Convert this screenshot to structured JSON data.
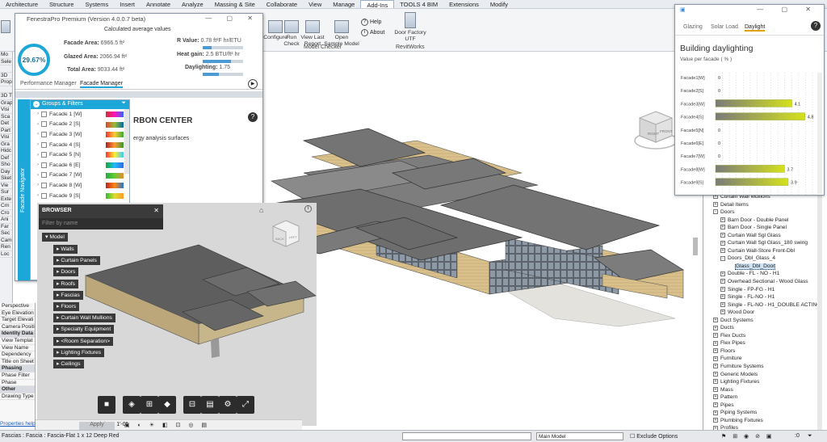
{
  "ribbon": {
    "tabs": [
      "Architecture",
      "Structure",
      "Systems",
      "Insert",
      "Annotate",
      "Analyze",
      "Massing & Site",
      "Collaborate",
      "View",
      "Manage",
      "Add-Ins",
      "TOOLS 4 BIM",
      "Extensions",
      "Modify"
    ],
    "active_tab": "Add-Ins",
    "buttons": {
      "configure": "Configure",
      "run_check": "Run\nCheck",
      "view_last_report": "View Last\nReport",
      "open_sample_model": "Open\nSample Model",
      "help": "Help",
      "about": "About",
      "door_factory": "Door Factory UTF"
    },
    "panels": {
      "model_checker": "Model Checker",
      "revitworks": "RevitWorks"
    }
  },
  "fenestrapro": {
    "title": "FenestraPro Premium (Version 4.0.0.7 beta)",
    "calc_title": "Calculated average values",
    "ratio": "29.67%",
    "facade_area_label": "Facade Area:",
    "facade_area_value": "6966.5 ft²",
    "glazed_area_label": "Glazed Area:",
    "glazed_area_value": "2066.94 ft²",
    "total_area_label": "Total Area:",
    "total_area_value": "9033.44 ft²",
    "r_value_label": "R Value:",
    "r_value": "0.78 ft²F hr/ETU",
    "heat_gain_label": "Heat gain:",
    "heat_gain": "2.5 BTU/ft² hr",
    "daylighting_label": "Daylighting:",
    "daylighting": "1.75",
    "tabs": [
      "Performance Manager",
      "Facade Manager"
    ],
    "active_tab": "Facade Manager",
    "groups_label": "Groups & Filters",
    "facade_navigator_label": "Facade Navigator",
    "right_title": "RBON CENTER",
    "right_sub": "ergy analysis surfaces",
    "facades": [
      "Facade 1 [W]",
      "Facade 2 [S]",
      "Facade 3 [W]",
      "Facade 4 [S]",
      "Facade 5 [N]",
      "Facade 6 [E]",
      "Facade 7 [W]",
      "Facade 8 [W]",
      "Facade 9 [S]"
    ]
  },
  "browser": {
    "title": "BROWSER",
    "filter_placeholder": "Filter by name",
    "root": "Model",
    "items": [
      "Walls",
      "Curtain Panels",
      "Doors",
      "Roofs",
      "Fascias",
      "Floors",
      "Curtain Wall Mullions",
      "Specialty Equipment",
      "<Room Separation>",
      "Lighting Fixtures",
      "Ceilings"
    ],
    "cube_labels": [
      "BACK",
      "LEFT"
    ]
  },
  "viewport": {
    "cube_labels": [
      "RIGHT",
      "FRONT"
    ]
  },
  "left_strip": [
    "Mo",
    "Sele",
    "",
    "3D",
    "Prop",
    "",
    "3D T",
    "Grap",
    "Visi",
    "Sca",
    "Det",
    "Part",
    "Visi",
    "Gra",
    "Hidc",
    "Def",
    "Sho",
    "Day",
    "Sket",
    "Vie",
    "Sur",
    "Exte",
    "Crn",
    "Cro",
    "Ani",
    "Far",
    "Sec",
    "Cam",
    "Ren",
    "Loc"
  ],
  "properties": [
    {
      "t": "Perspective",
      "h": false
    },
    {
      "t": "Eye Elevation",
      "h": false
    },
    {
      "t": "Target Elevati",
      "h": false
    },
    {
      "t": "Camera Positi",
      "h": false
    },
    {
      "t": "Identity Data",
      "h": true
    },
    {
      "t": "View Templat",
      "h": false
    },
    {
      "t": "View Name",
      "h": false
    },
    {
      "t": "Dependency",
      "h": false
    },
    {
      "t": "Title on Sheet",
      "h": false
    },
    {
      "t": "Phasing",
      "h": true
    },
    {
      "t": "Phase Filter",
      "h": false
    },
    {
      "t": "Phase",
      "h": false
    },
    {
      "t": "Other",
      "h": true
    },
    {
      "t": "Drawing Type",
      "h": false
    }
  ],
  "properties_help": "Properties help",
  "apply_label": "Apply",
  "daylight": {
    "tabs": [
      "Glazing",
      "Solar Load",
      "Daylight"
    ],
    "active_tab": "Daylight",
    "heading": "Building daylighting",
    "subheading": "Value per facade ( % )"
  },
  "chart_data": {
    "type": "bar",
    "orientation": "horizontal",
    "title": "Building daylighting",
    "subtitle": "Value per facade ( % )",
    "categories": [
      "Facade1[W]",
      "Facade2[S]",
      "Facade3[W]",
      "Facade4[S]",
      "Facade5[N]",
      "Facade6[E]",
      "Facade7[W]",
      "Facade8[W]",
      "Facade9[S]"
    ],
    "values": [
      0,
      0,
      4.1,
      4.8,
      0,
      0,
      0,
      3.7,
      3.9
    ],
    "value_labels": [
      "0",
      "0",
      "4.1",
      "4.8",
      "0",
      "0",
      "0",
      "3.7",
      "3.9"
    ],
    "xlim": [
      0,
      5.2
    ],
    "bar_colors": {
      "start": "#7a7a7a",
      "end": "#d4e21a"
    }
  },
  "project_tree": [
    {
      "t": "Curtain Wall Mullions",
      "lvl": 1,
      "pm": "+"
    },
    {
      "t": "Detail Items",
      "lvl": 1,
      "pm": "+"
    },
    {
      "t": "Doors",
      "lvl": 1,
      "pm": "-"
    },
    {
      "t": "Barn Door - Double Panel",
      "lvl": 2,
      "pm": "+"
    },
    {
      "t": "Barn Door - Single Panel",
      "lvl": 2,
      "pm": "+"
    },
    {
      "t": "Curtain Wall Sgl Glass",
      "lvl": 2,
      "pm": "+"
    },
    {
      "t": "Curtain Wall Sgl Glass_180 swing",
      "lvl": 2,
      "pm": "+"
    },
    {
      "t": "Curtain Wall-Store Front-Dbl",
      "lvl": 2,
      "pm": "+"
    },
    {
      "t": "Doors_Dbl_Glass_4",
      "lvl": 2,
      "pm": "-"
    },
    {
      "t": "Glass_Dbl_Door",
      "lvl": 3,
      "pm": "",
      "sel": true
    },
    {
      "t": "Double - FL - NO - H1",
      "lvl": 2,
      "pm": "+"
    },
    {
      "t": "Overhead Sectional - Wood Glass",
      "lvl": 2,
      "pm": "+"
    },
    {
      "t": "Single - FP-FG - H1",
      "lvl": 2,
      "pm": "+"
    },
    {
      "t": "Single - FL-NO - H1",
      "lvl": 2,
      "pm": "+"
    },
    {
      "t": "Single - FL-NO - H1_DOUBLE ACTING",
      "lvl": 2,
      "pm": "+"
    },
    {
      "t": "Wood Door",
      "lvl": 2,
      "pm": "+"
    },
    {
      "t": "Duct Systems",
      "lvl": 1,
      "pm": "+"
    },
    {
      "t": "Ducts",
      "lvl": 1,
      "pm": "+"
    },
    {
      "t": "Flex Ducts",
      "lvl": 1,
      "pm": "+"
    },
    {
      "t": "Flex Pipes",
      "lvl": 1,
      "pm": "+"
    },
    {
      "t": "Floors",
      "lvl": 1,
      "pm": "+"
    },
    {
      "t": "Furniture",
      "lvl": 1,
      "pm": "+"
    },
    {
      "t": "Furniture Systems",
      "lvl": 1,
      "pm": "+"
    },
    {
      "t": "Generic Models",
      "lvl": 1,
      "pm": "+"
    },
    {
      "t": "Lighting Fixtures",
      "lvl": 1,
      "pm": "+"
    },
    {
      "t": "Mass",
      "lvl": 1,
      "pm": "+"
    },
    {
      "t": "Pattern",
      "lvl": 1,
      "pm": "+"
    },
    {
      "t": "Pipes",
      "lvl": 1,
      "pm": "+"
    },
    {
      "t": "Piping Systems",
      "lvl": 1,
      "pm": "+"
    },
    {
      "t": "Plumbing Fixtures",
      "lvl": 1,
      "pm": "+"
    },
    {
      "t": "Profiles",
      "lvl": 1,
      "pm": "+"
    }
  ],
  "status": {
    "selection": "Fascias : Fascia : Fascia-Flat 1 x 12 Deep Red",
    "scale": "1/8\" = 1'-0\"",
    "workset": "Main Model",
    "exclude_options": "Exclude Options",
    "selection_count": ":0"
  }
}
